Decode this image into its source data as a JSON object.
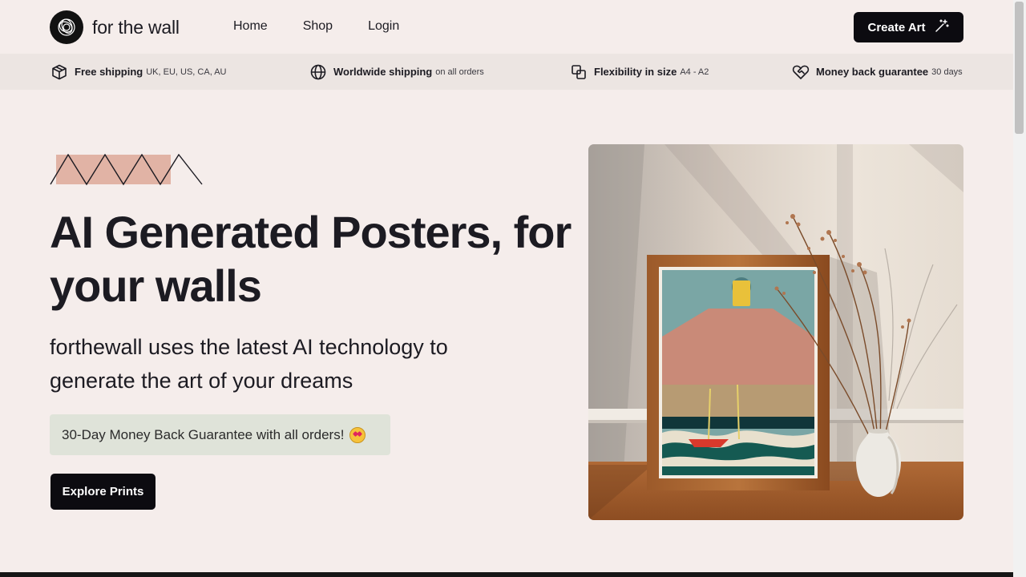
{
  "nav": {
    "logo_text": "for the wall",
    "links": [
      "Home",
      "Shop",
      "Login"
    ],
    "create_label": "Create Art"
  },
  "features": [
    {
      "icon": "box-icon",
      "title": "Free shipping",
      "sub": "UK, EU, US, CA, AU"
    },
    {
      "icon": "globe-icon",
      "title": "Worldwide shipping",
      "sub": "on all orders"
    },
    {
      "icon": "resize-icon",
      "title": "Flexibility in size",
      "sub": "A4 - A2"
    },
    {
      "icon": "heart-handshake-icon",
      "title": "Money back guarantee",
      "sub": "30 days"
    }
  ],
  "hero": {
    "title": "AI Generated Posters, for your walls",
    "subtitle": "forthewall uses the latest AI technology to generate the art of your dreams",
    "guarantee": "30-Day Money Back Guarantee with all orders!",
    "guarantee_emoji": "star-struck-emoji",
    "cta_label": "Explore Prints"
  },
  "colors": {
    "background": "#f5edeb",
    "feature_bar": "#ece5e2",
    "guarantee_bg": "#dfe3d9",
    "button": "#0c0b10",
    "zigzag_accent": "#e1b3a5"
  }
}
